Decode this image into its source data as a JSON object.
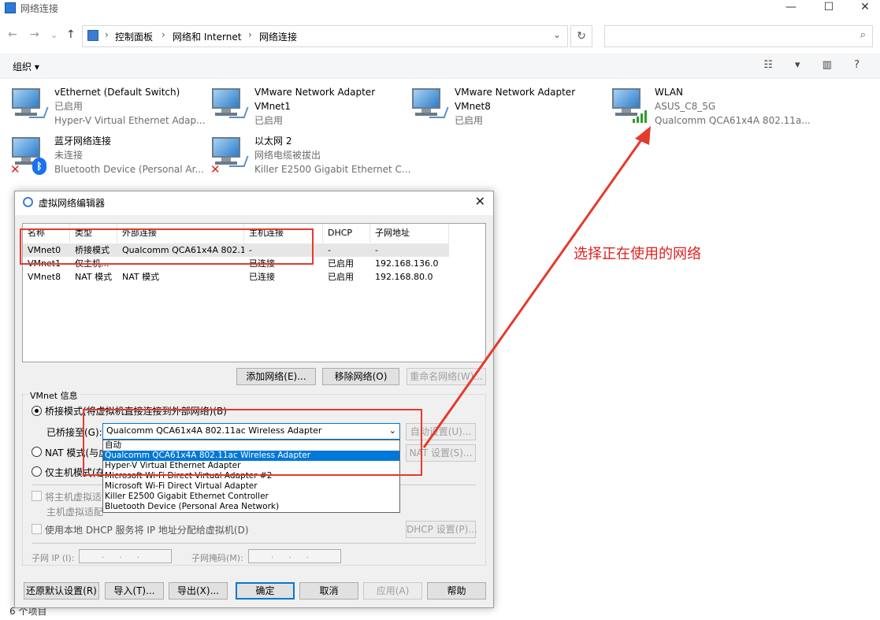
{
  "window": {
    "title": "网络连接",
    "minimize": "—",
    "maximize": "☐",
    "close": "✕"
  },
  "address": {
    "crumbs": [
      "控制面板",
      "网络和 Internet",
      "网络连接"
    ],
    "dropdown": "⌄",
    "refresh": "↻",
    "search_placeholder": ""
  },
  "nav": {
    "back": "←",
    "forward": "→",
    "recent": "⌄",
    "up": "↑"
  },
  "toolbar": {
    "organize": "组织 ▾",
    "view_icons": "☷ ▾ ▥ ?"
  },
  "adapters": [
    {
      "name": "vEthernet (Default Switch)",
      "status": "已启用",
      "device": "Hyper-V Virtual Ethernet Adap...",
      "state": "ok"
    },
    {
      "name": "VMware Network Adapter",
      "status": "VMnet1",
      "device": "已启用",
      "state": "ok"
    },
    {
      "name": "VMware Network Adapter",
      "status": "VMnet8",
      "device": "已启用",
      "state": "ok"
    },
    {
      "name": "WLAN",
      "status": "ASUS_C8_5G",
      "device": "Qualcomm QCA61x4A 802.11a...",
      "state": "wifi"
    },
    {
      "name": "蓝牙网络连接",
      "status": "未连接",
      "device": "Bluetooth Device (Personal Ar...",
      "state": "bt"
    },
    {
      "name": "以太网 2",
      "status": "网络电缆被拔出",
      "device": "Killer E2500 Gigabit Ethernet C...",
      "state": "err"
    }
  ],
  "statusbar": {
    "count": "6 个项目"
  },
  "dialog": {
    "title": "虚拟网络编辑器",
    "close": "✕",
    "columns": [
      "名称",
      "类型",
      "外部连接",
      "主机连接",
      "DHCP",
      "子网地址"
    ],
    "rows": [
      [
        "VMnet0",
        "桥接模式",
        "Qualcomm QCA61x4A 802.1...",
        "-",
        "-",
        "-"
      ],
      [
        "VMnet1",
        "仅主机...",
        "",
        "已连接",
        "已启用",
        "192.168.136.0"
      ],
      [
        "VMnet8",
        "NAT 模式",
        "NAT 模式",
        "已连接",
        "已启用",
        "192.168.80.0"
      ]
    ],
    "add_network": "添加网络(E)...",
    "remove_network": "移除网络(O)",
    "rename_network": "重命名网络(W)...",
    "vmnet_info": "VMnet 信息",
    "bridge_mode": "桥接模式(将虚拟机直接连接到外部网络)(B)",
    "bridged_to_label": "已桥接至(G):",
    "bridged_to_value": "Qualcomm QCA61x4A 802.11ac Wireless Adapter",
    "auto_settings": "自动设置(U)...",
    "nat_mode": "NAT 模式(与虚",
    "nat_settings": "NAT 设置(S)...",
    "host_only_mode": "仅主机模式(在",
    "connect_host_adapter": "将主机虚拟适",
    "host_adapter_name": "主机虚拟适配",
    "use_dhcp": "使用本地 DHCP 服务将 IP 地址分配给虚拟机(D)",
    "dhcp_settings": "DHCP 设置(P)...",
    "subnet_ip_label": "子网 IP (I):",
    "subnet_mask_label": "子网掩码(M):",
    "ip_placeholder": "   .   .   .",
    "restore_defaults": "还原默认设置(R)",
    "import": "导入(T)...",
    "export": "导出(X)...",
    "ok": "确定",
    "cancel": "取消",
    "apply": "应用(A)",
    "help": "帮助",
    "dropdown_options": [
      "自动",
      "Qualcomm QCA61x4A 802.11ac Wireless Adapter",
      "Hyper-V Virtual Ethernet Adapter",
      "Microsoft Wi-Fi Direct Virtual Adapter #2",
      "Microsoft Wi-Fi Direct Virtual Adapter",
      "Killer E2500 Gigabit Ethernet Controller",
      "Bluetooth Device (Personal Area Network)"
    ],
    "dropdown_selected_index": 1
  },
  "annotation": {
    "text": "选择正在使用的网络",
    "color": "#e02020"
  }
}
